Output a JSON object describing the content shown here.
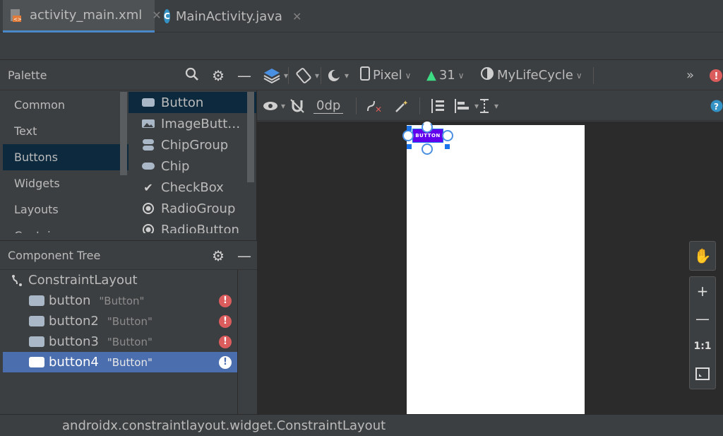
{
  "tabs": [
    {
      "label": "activity_main.xml",
      "icon": "xml-layout-icon",
      "active": true
    },
    {
      "label": "MainActivity.java",
      "icon": "java-class-icon",
      "active": false
    }
  ],
  "palette": {
    "title": "Palette",
    "categories": [
      "Common",
      "Text",
      "Buttons",
      "Widgets",
      "Layouts",
      "Containers"
    ],
    "selected_category": "Buttons",
    "items": [
      {
        "label": "Button",
        "icon": "button-icon"
      },
      {
        "label": "ImageButt…",
        "icon": "image-button-icon"
      },
      {
        "label": "ChipGroup",
        "icon": "chipgroup-icon"
      },
      {
        "label": "Chip",
        "icon": "chip-icon"
      },
      {
        "label": "CheckBox",
        "icon": "checkbox-icon"
      },
      {
        "label": "RadioGroup",
        "icon": "radiogroup-icon"
      },
      {
        "label": "RadioButton",
        "icon": "radiobutton-icon"
      }
    ]
  },
  "toolbar": {
    "device": "Pixel",
    "api": "31",
    "theme": "MyLifeCycle",
    "margin": "0dp"
  },
  "component_tree": {
    "title": "Component Tree",
    "root": "ConstraintLayout",
    "children": [
      {
        "name": "button",
        "hint": "\"Button\"",
        "error": true
      },
      {
        "name": "button2",
        "hint": "\"Button\"",
        "error": true
      },
      {
        "name": "button3",
        "hint": "\"Button\"",
        "error": true
      },
      {
        "name": "button4",
        "hint": "\"Button\"",
        "error": true,
        "selected": true
      }
    ]
  },
  "canvas": {
    "button_text": "BUTTON"
  },
  "zoom": {
    "fit_label": "1:1"
  },
  "status": {
    "text": "androidx.constraintlayout.widget.ConstraintLayout"
  },
  "colors": {
    "accent": "#4a88c7",
    "selection": "#4b6eaf",
    "error": "#db5c5c",
    "button_purple": "#6200ee"
  }
}
